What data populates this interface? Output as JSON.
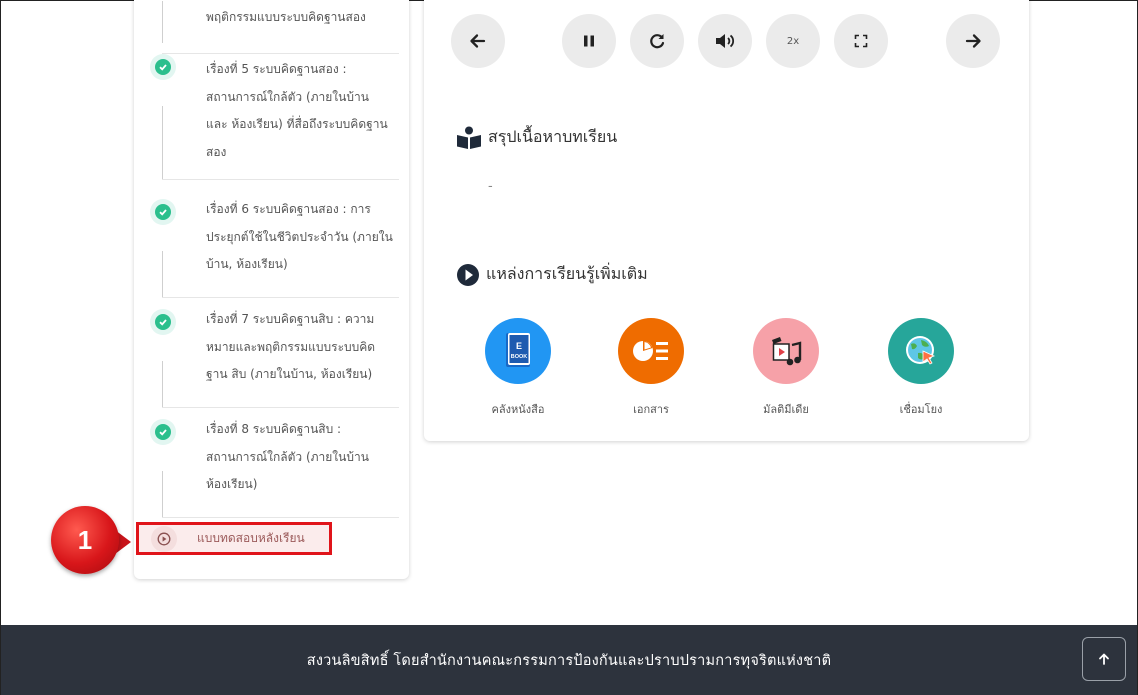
{
  "sidebar": {
    "items": [
      {
        "lines": [
          "พฤติกรรมแบบระบบคิดฐานสอง"
        ]
      },
      {
        "lines": [
          "เรื่องที่ 5 ระบบคิดฐานสอง :",
          "สถานการณ์ใกล้ตัว (ภายในบ้าน",
          "และ ห้องเรียน) ที่สื่อถึงระบบคิดฐาน",
          "สอง"
        ]
      },
      {
        "lines": [
          "เรื่องที่ 6 ระบบคิดฐานสอง : การ",
          "ประยุกต์ใช้ในชีวิตประจำวัน (ภายใน",
          "บ้าน, ห้องเรียน)"
        ]
      },
      {
        "lines": [
          "เรื่องที่ 7 ระบบคิดฐานสิบ : ความ",
          "หมายและพฤติกรรมแบบระบบคิด",
          "ฐาน สิบ (ภายในบ้าน, ห้องเรียน)"
        ]
      },
      {
        "lines": [
          "เรื่องที่ 8 ระบบคิดฐานสิบ :",
          "สถานการณ์ใกล้ตัว (ภายในบ้าน",
          "ห้องเรียน)"
        ]
      }
    ],
    "posttest_label": "แบบทดสอบหลังเรียน"
  },
  "callout": {
    "number": "1"
  },
  "player": {
    "icons": [
      "arrow-left-icon",
      "pause-icon",
      "replay-icon",
      "volume-icon",
      "speed-icon",
      "fullscreen-icon",
      "arrow-right-icon"
    ],
    "speed_label": "2x"
  },
  "summary": {
    "title": "สรุปเนื้อหาบทเรียน",
    "text": "-"
  },
  "resources": {
    "title": "แหล่งการเรียนรู้เพิ่มเติม",
    "items": [
      {
        "label": "คลังหนังสือ",
        "icon": "book-icon",
        "color": "#2196f3",
        "badge": "BOOK"
      },
      {
        "label": "เอกสาร",
        "icon": "document-chart-icon",
        "color": "#ef6c00"
      },
      {
        "label": "มัลติมีเดีย",
        "icon": "multimedia-icon",
        "color": "#f6a1a8"
      },
      {
        "label": "เชื่อมโยง",
        "icon": "globe-link-icon",
        "color": "#26a69a"
      }
    ]
  },
  "footer": {
    "copyright": "สงวนลิขสิทธิ์ โดยสำนักงานคณะกรรมการป้องกันและปราบปรามการทุจริตแห่งชาติ"
  }
}
